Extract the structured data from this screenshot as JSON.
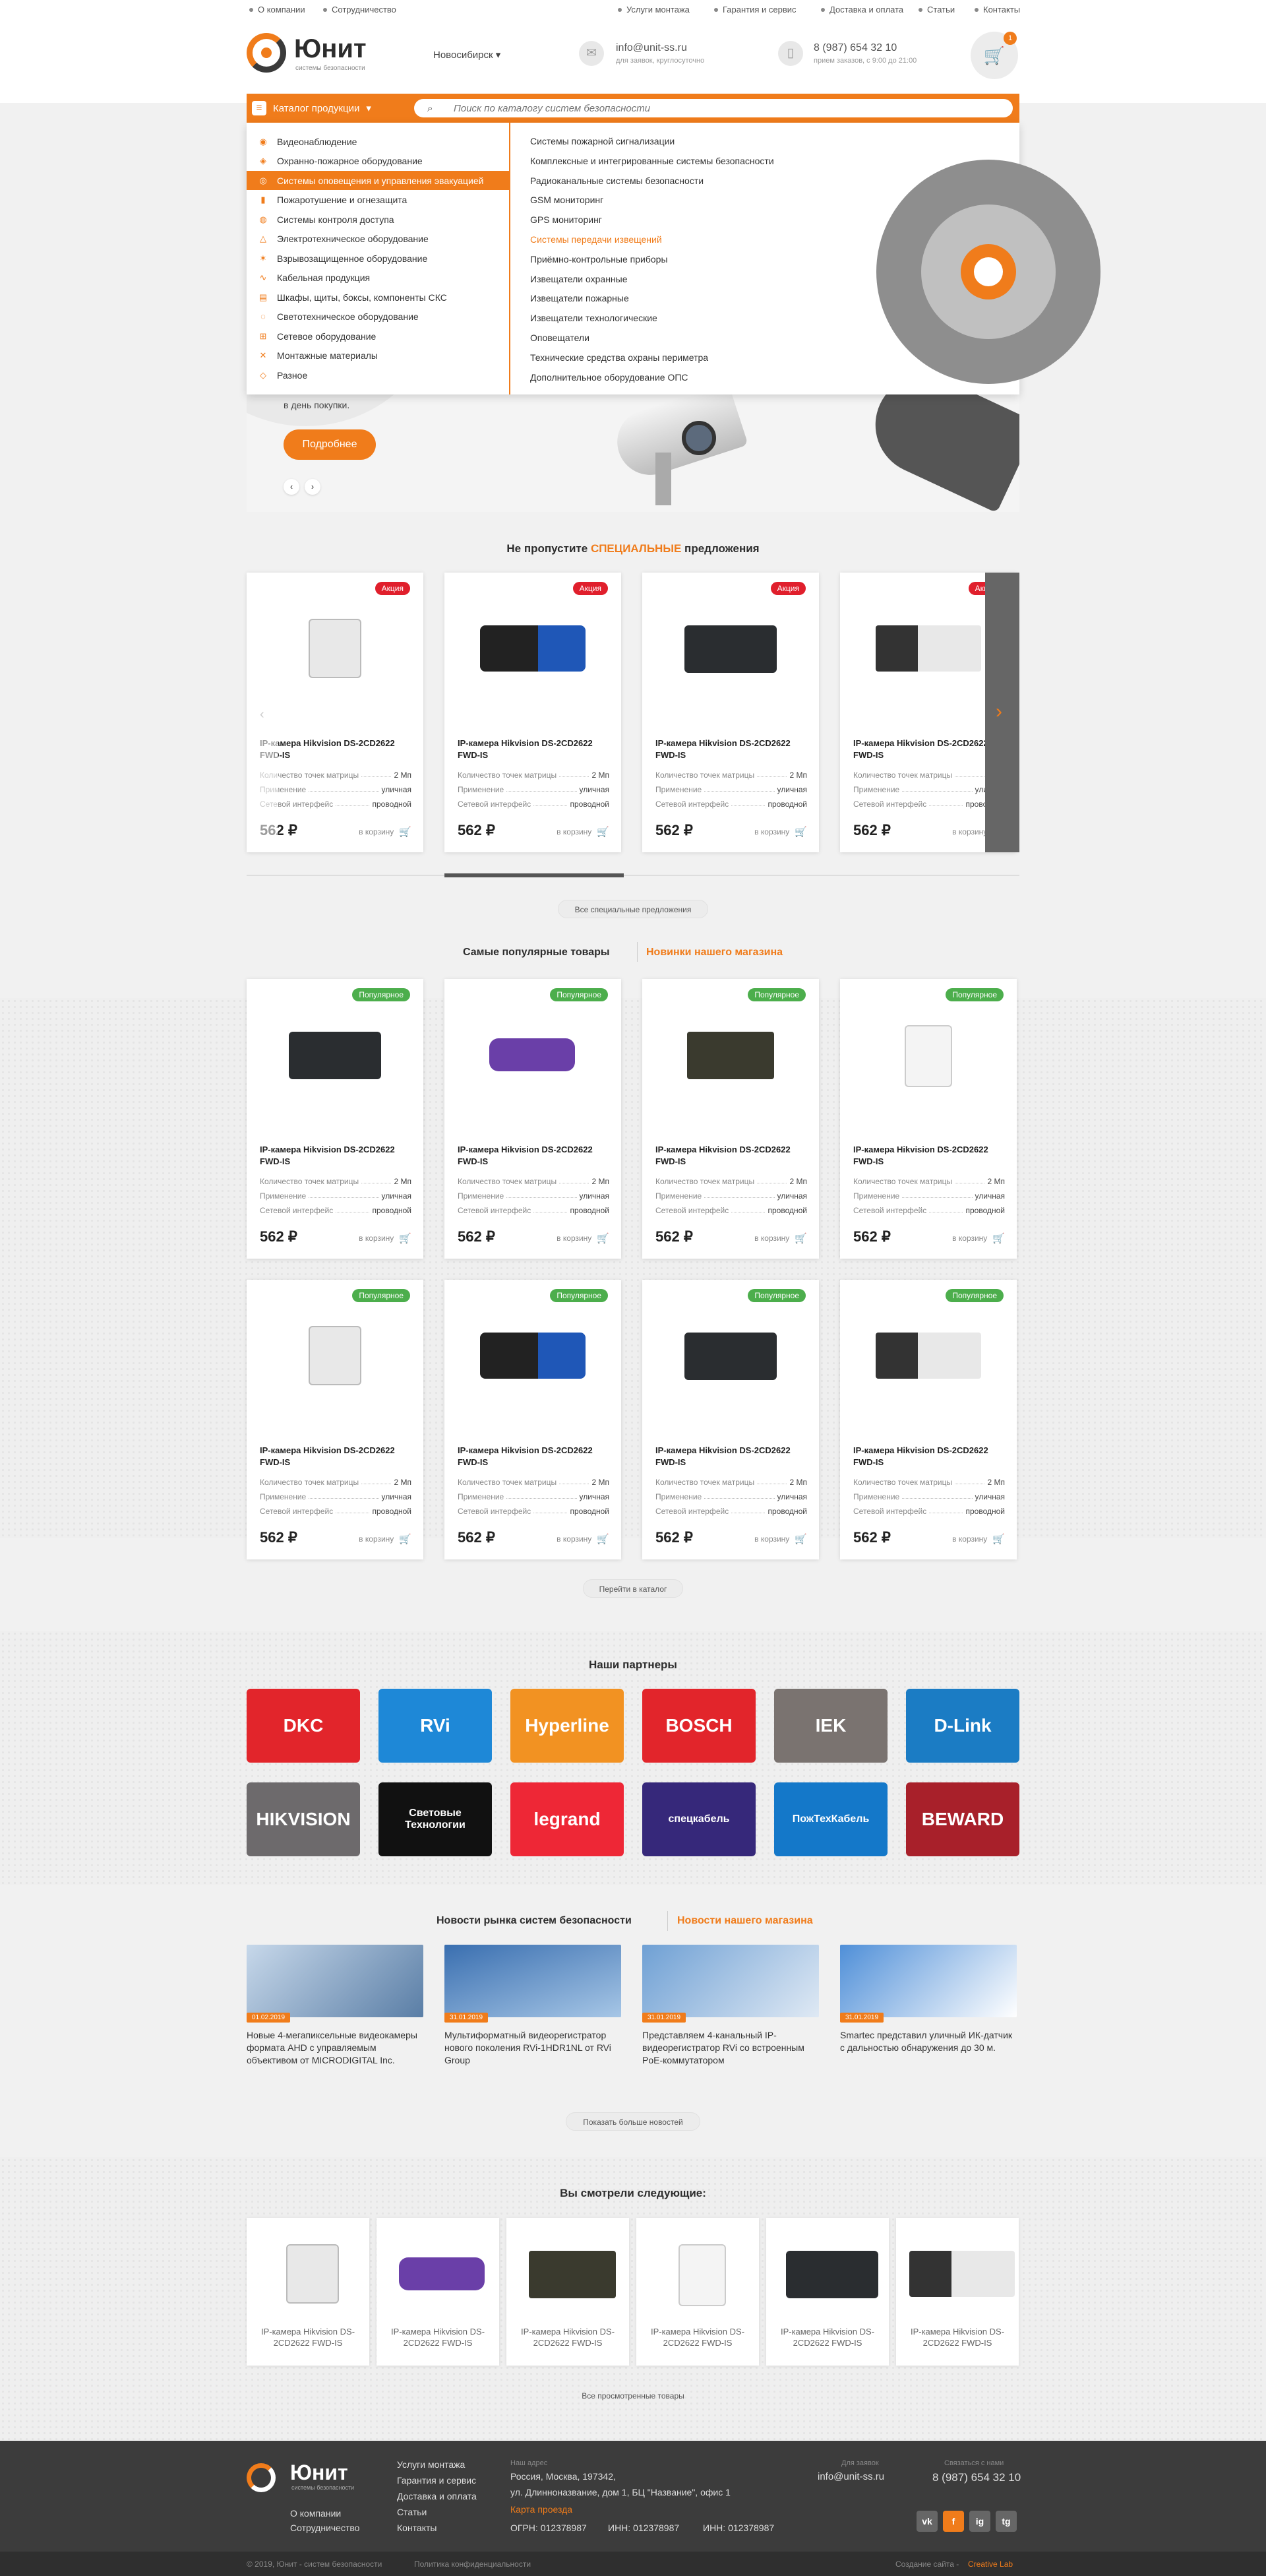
{
  "topbar": {
    "left": [
      "О компании",
      "Сотрудничество"
    ],
    "right": [
      "Услуги монтажа",
      "Гарантия и сервис",
      "Доставка и оплата",
      "Статьи",
      "Контакты"
    ]
  },
  "header": {
    "logo": "Юнит",
    "logo_sub": "системы безопасности",
    "city": "Новосибирск",
    "email": "info@unit-ss.ru",
    "email_note": "для заявок, круглосуточно",
    "phone": "8 (987) 654 32 10",
    "phone_note": "прием заказов, с 9:00 до 21:00",
    "cart_count": "1"
  },
  "catalog": {
    "button": "Каталог продукции",
    "search_placeholder": "Поиск по каталогу систем безопасности",
    "categories": [
      {
        "label": "Видеонаблюдение",
        "icon": "camera-icon"
      },
      {
        "label": "Охранно-пожарное оборудование",
        "icon": "shield-icon"
      },
      {
        "label": "Системы оповещения и управления эвакуацией",
        "icon": "eye-icon"
      },
      {
        "label": "Пожаротушение и огнезащита",
        "icon": "extinguisher-icon"
      },
      {
        "label": "Системы контроля доступа",
        "icon": "fingerprint-icon"
      },
      {
        "label": "Электротехническое оборудование",
        "icon": "warning-icon"
      },
      {
        "label": "Взрывозащищенное оборудование",
        "icon": "explosion-icon"
      },
      {
        "label": "Кабельная продукция",
        "icon": "cable-icon"
      },
      {
        "label": "Шкафы, щиты, боксы, компоненты СКС",
        "icon": "cabinet-icon"
      },
      {
        "label": "Светотехническое оборудование",
        "icon": "bulb-icon"
      },
      {
        "label": "Сетевое оборудование",
        "icon": "network-icon"
      },
      {
        "label": "Монтажные материалы",
        "icon": "tools-icon"
      },
      {
        "label": "Разное",
        "icon": "misc-icon"
      }
    ],
    "active_index": 2,
    "subcategories": [
      "Системы пожарной сигнализации",
      "Комплексные и интегрированные системы безопасности",
      "Радиоканальные системы безопасности",
      "GSM мониторинг",
      "GPS мониторинг",
      "Системы передачи извещений",
      "Приёмно-контрольные приборы",
      "Извещатели охранные",
      "Извещатели пожарные",
      "Извещатели технологические",
      "Оповещатели",
      "Технические средства охраны периметра",
      "Дополнительное оборудование ОПС"
    ],
    "highlighted_sub": 5
  },
  "hero": {
    "text": "в день покупки.",
    "button": "Подробнее"
  },
  "specials": {
    "title_a": "Не пропустите",
    "title_b": "СПЕЦИАЛЬНЫЕ",
    "title_c": "предложения",
    "badge": "Акция",
    "all_button": "Все специальные предложения"
  },
  "product": {
    "title": "IP-камера Hikvision DS-2CD2622 FWD-IS",
    "props": [
      {
        "k": "Количество точек матрицы",
        "v": "2 Мп"
      },
      {
        "k": "Применение",
        "v": "уличная"
      },
      {
        "k": "Сетевой интерфейс",
        "v": "проводной"
      }
    ],
    "price": "562 ₽",
    "cart": "в корзину"
  },
  "popular": {
    "tab_a": "Самые популярные товары",
    "tab_b": "Новинки нашего магазина",
    "badge": "Популярное",
    "button": "Перейти в каталог"
  },
  "partners": {
    "title": "Наши партнеры",
    "items": [
      {
        "name": "DKC",
        "bg": "#e2252b"
      },
      {
        "name": "RVi",
        "bg": "#1e88d7"
      },
      {
        "name": "Hyperline",
        "bg": "#f29222"
      },
      {
        "name": "BOSCH",
        "bg": "#e2252b"
      },
      {
        "name": "IEK",
        "bg": "#7a7370"
      },
      {
        "name": "D-Link",
        "bg": "#1b7cc4"
      },
      {
        "name": "HIKVISION",
        "bg": "#6d6a6c"
      },
      {
        "name": "Световые Технологии",
        "bg": "#111111"
      },
      {
        "name": "legrand",
        "bg": "#ee2736"
      },
      {
        "name": "спецкабель",
        "bg": "#36287a"
      },
      {
        "name": "ПожТехКабель",
        "bg": "#1478c9"
      },
      {
        "name": "BEWARD",
        "bg": "#a8202a"
      }
    ]
  },
  "news": {
    "tab_a": "Новости рынка систем безопасности",
    "tab_b": "Новости нашего магазина",
    "items": [
      {
        "date": "01.02.2019",
        "text": "Новые 4-мегапиксельные видеокамеры формата AHD с управляемым объективом от MICRODIGITAL Inc."
      },
      {
        "date": "31.01.2019",
        "text": "Мультиформатный видеорегистратор нового поколения RVi-1HDR1NL от RVi Group"
      },
      {
        "date": "31.01.2019",
        "text": "Представляем 4-канальный IP-видеорегистратор RVi со встроенным PoE-коммутатором"
      },
      {
        "date": "31.01.2019",
        "text": "Smartec представил уличный ИК-датчик с дальностью обнаружения до 30 м."
      }
    ],
    "button": "Показать больше новостей"
  },
  "viewed": {
    "title": "Вы смотрели следующие:",
    "item_title": "IP-камера Hikvision DS-2CD2622 FWD-IS",
    "button": "Все просмотренные товары"
  },
  "footer": {
    "logo": "Юнит",
    "logo_sub": "системы безопасности",
    "links_a": [
      "О компании",
      "Сотрудничество"
    ],
    "links_b": [
      "Услуги монтажа",
      "Гарантия и сервис",
      "Доставка и оплата",
      "Статьи",
      "Контакты"
    ],
    "addr_label": "Наш адрес",
    "addr": "Россия, Москва, 197342,",
    "addr2": "ул. Длинноназвание, дом 1, БЦ \"Название\", офис 1",
    "map": "Карта проезда",
    "ogrn": "ОГРН: 012378987",
    "inn1": "ИНН: 012378987",
    "inn2": "ИНН: 012378987",
    "email_label": "Для заявок",
    "email": "info@unit-ss.ru",
    "phone_label": "Связаться с нами",
    "phone": "8 (987) 654 32 10",
    "copyright": "© 2019, Юнит - систем безопасности",
    "privacy": "Политика конфиденциальности",
    "made_by": "Создание сайта -",
    "made_by_link": "Creative Lab",
    "social": [
      "vk",
      "f",
      "ig",
      "tg"
    ]
  },
  "colors": {
    "accent": "#f07c1b",
    "dark": "#3c3c3c"
  }
}
